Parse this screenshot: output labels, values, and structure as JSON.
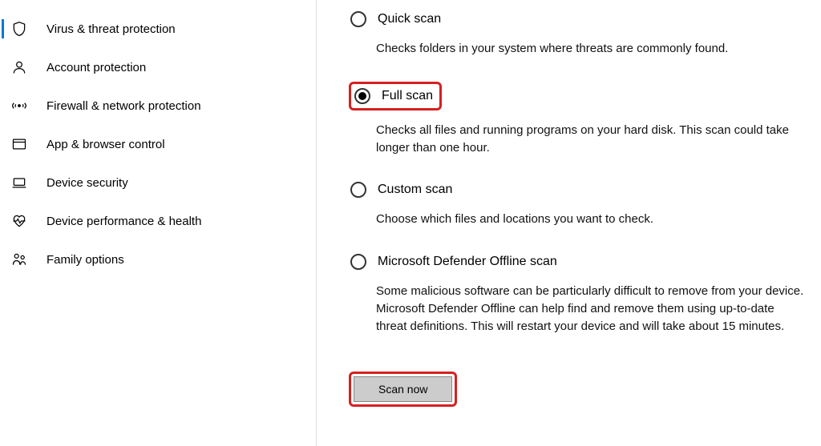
{
  "sidebar": {
    "items": [
      {
        "label": "Virus & threat protection",
        "icon": "shield-icon",
        "active": true
      },
      {
        "label": "Account protection",
        "icon": "person-icon",
        "active": false
      },
      {
        "label": "Firewall & network protection",
        "icon": "antenna-icon",
        "active": false
      },
      {
        "label": "App & browser control",
        "icon": "browser-icon",
        "active": false
      },
      {
        "label": "Device security",
        "icon": "device-icon",
        "active": false
      },
      {
        "label": "Device performance & health",
        "icon": "heart-icon",
        "active": false
      },
      {
        "label": "Family options",
        "icon": "family-icon",
        "active": false
      }
    ]
  },
  "main": {
    "scan_options": [
      {
        "id": "quick",
        "label": "Quick scan",
        "description": "Checks folders in your system where threats are commonly found.",
        "selected": false,
        "highlighted": false
      },
      {
        "id": "full",
        "label": "Full scan",
        "description": "Checks all files and running programs on your hard disk. This scan could take longer than one hour.",
        "selected": true,
        "highlighted": true
      },
      {
        "id": "custom",
        "label": "Custom scan",
        "description": "Choose which files and locations you want to check.",
        "selected": false,
        "highlighted": false
      },
      {
        "id": "offline",
        "label": "Microsoft Defender Offline scan",
        "description": "Some malicious software can be particularly difficult to remove from your device. Microsoft Defender Offline can help find and remove them using up-to-date threat definitions. This will restart your device and will take about 15 minutes.",
        "selected": false,
        "highlighted": false
      }
    ],
    "scan_button": "Scan now"
  },
  "colors": {
    "accent": "#0078d4",
    "highlight": "#d62020"
  }
}
